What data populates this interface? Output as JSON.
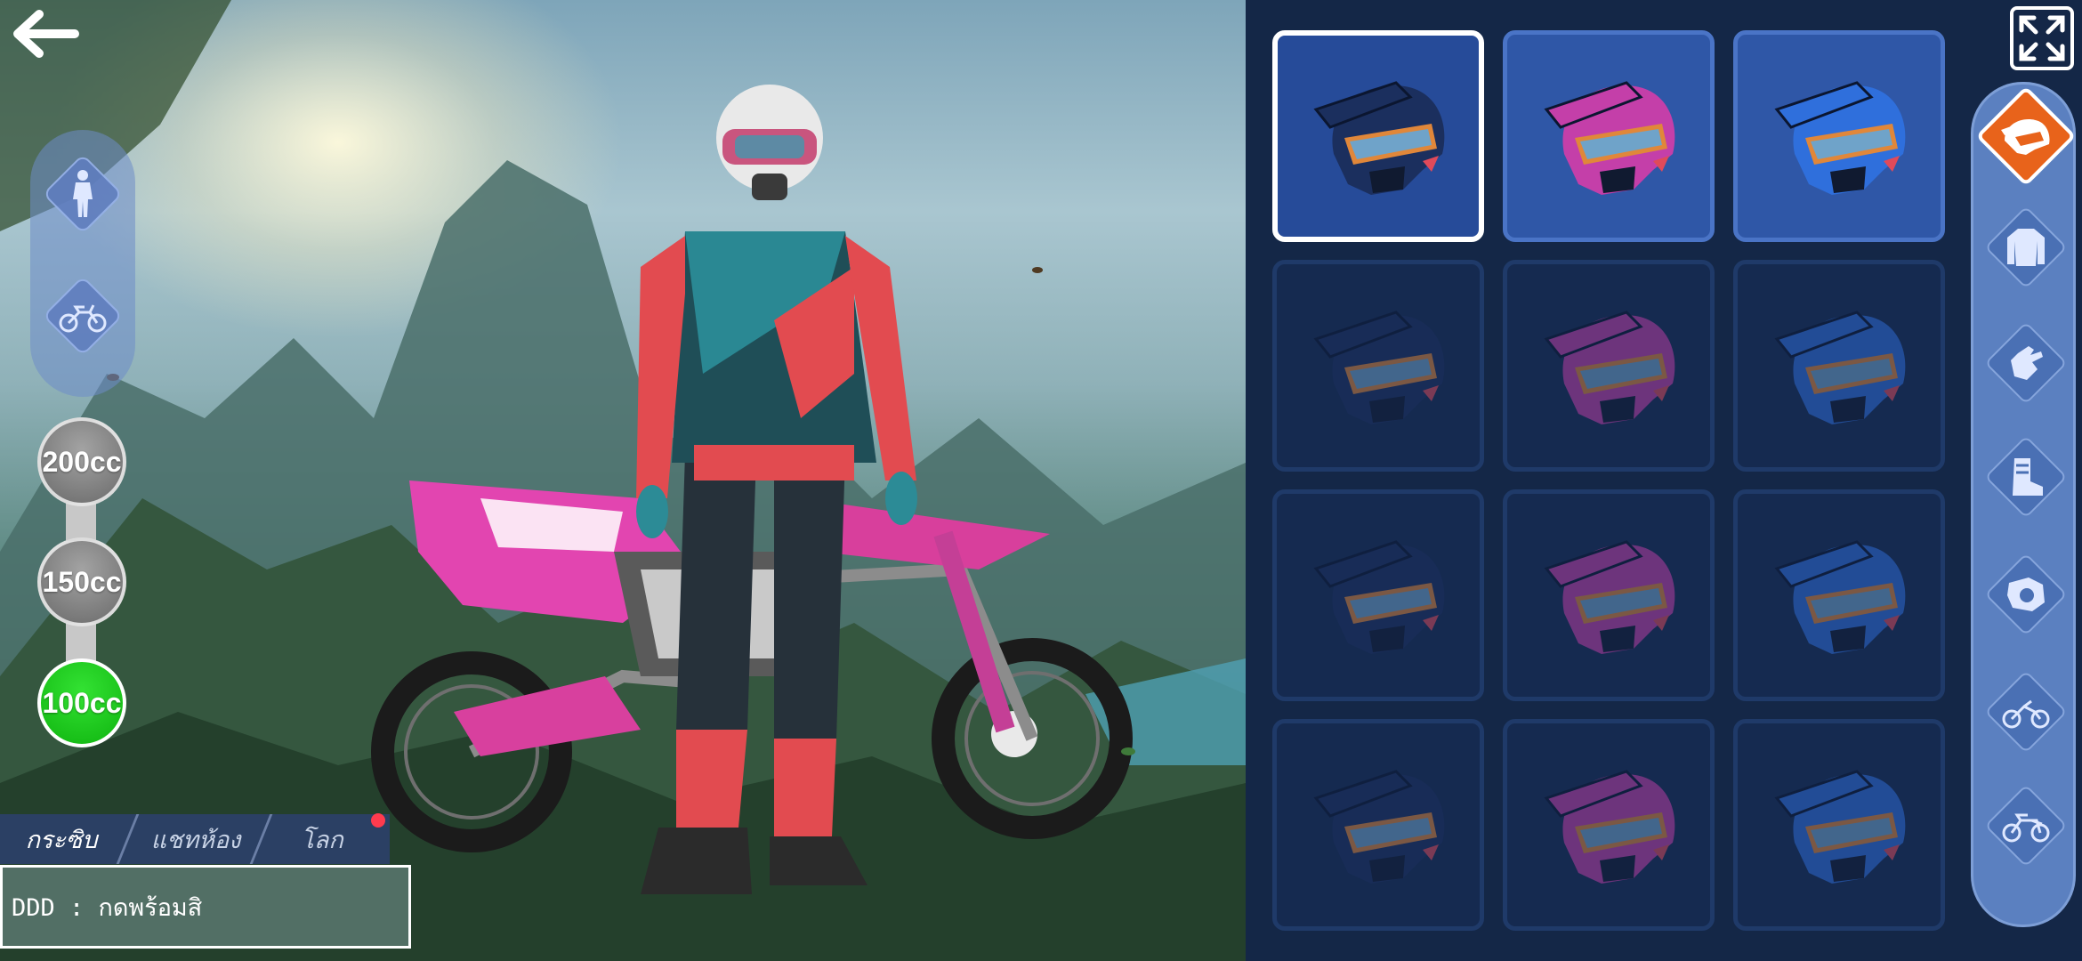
{
  "header": {
    "back_icon": "back-arrow-icon"
  },
  "mode_selector": [
    {
      "name": "rider",
      "icon": "rider-icon"
    },
    {
      "name": "bike",
      "icon": "motorbike-icon"
    }
  ],
  "cc_selector": {
    "options": [
      {
        "label": "200cc",
        "selected": false
      },
      {
        "label": "150cc",
        "selected": false
      },
      {
        "label": "100cc",
        "selected": true
      }
    ]
  },
  "chat": {
    "tabs": [
      {
        "label": "กระซิบ",
        "active": true
      },
      {
        "label": "แชทห้อง",
        "active": false
      },
      {
        "label": "โลก",
        "active": false
      }
    ],
    "has_notification": true,
    "message": "DDD : กดพร้อมสิ"
  },
  "helmet_grid": {
    "rows": 4,
    "cols": 3,
    "colors": [
      "#1b2f5e",
      "#c43fa9",
      "#2f6fdc"
    ],
    "items": [
      {
        "color": "navy",
        "state": "selected"
      },
      {
        "color": "pink",
        "state": "owned"
      },
      {
        "color": "blue",
        "state": "owned"
      },
      {
        "color": "navy",
        "state": "locked"
      },
      {
        "color": "pink",
        "state": "locked"
      },
      {
        "color": "blue",
        "state": "locked"
      },
      {
        "color": "navy",
        "state": "locked"
      },
      {
        "color": "pink",
        "state": "locked"
      },
      {
        "color": "blue",
        "state": "locked"
      },
      {
        "color": "navy",
        "state": "locked"
      },
      {
        "color": "pink",
        "state": "locked"
      },
      {
        "color": "blue",
        "state": "locked"
      }
    ]
  },
  "categories": [
    {
      "name": "helmet",
      "icon": "helmet-icon",
      "active": true
    },
    {
      "name": "jersey",
      "icon": "jersey-icon",
      "active": false
    },
    {
      "name": "gloves",
      "icon": "glove-icon",
      "active": false
    },
    {
      "name": "boots",
      "icon": "boot-icon",
      "active": false
    },
    {
      "name": "engine",
      "icon": "engine-icon",
      "active": false
    },
    {
      "name": "frame",
      "icon": "bike-frame-icon",
      "active": false
    },
    {
      "name": "bike",
      "icon": "motorbike-icon",
      "active": false
    }
  ],
  "colors": {
    "accent": "#e8631b",
    "cc_selected": "#11c811",
    "panel": "#142747"
  },
  "fullscreen_icon": "fullscreen-icon"
}
